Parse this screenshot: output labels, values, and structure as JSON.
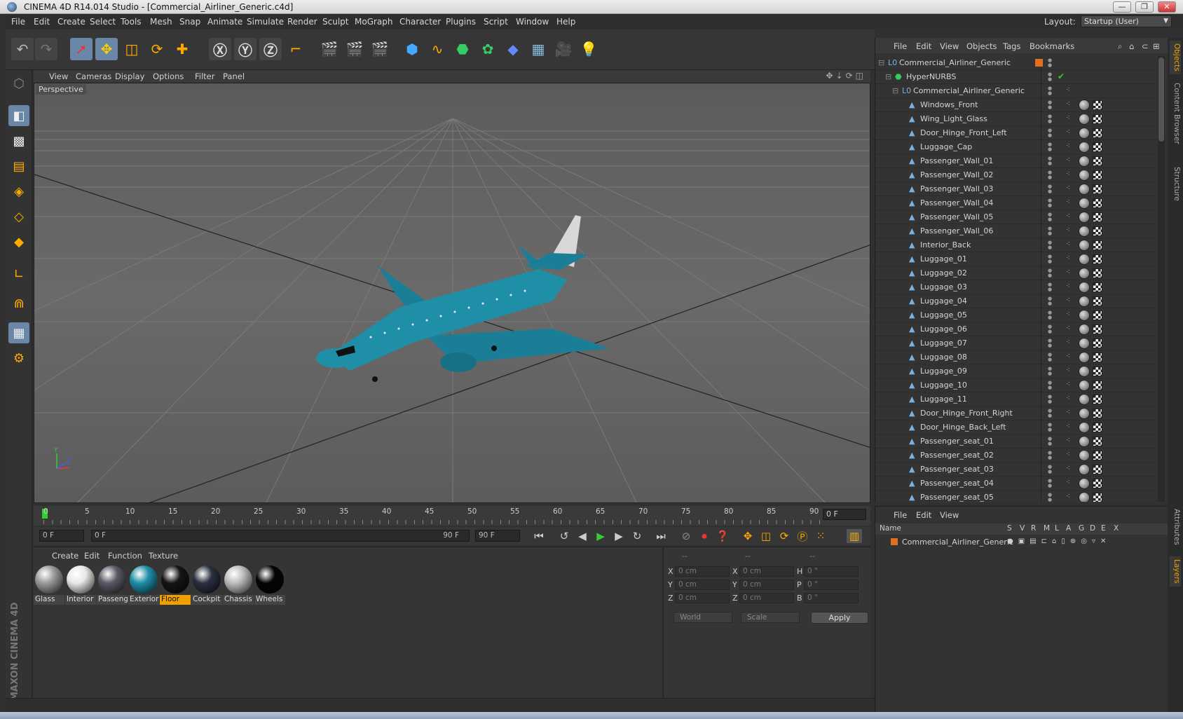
{
  "window": {
    "title": "CINEMA 4D R14.014 Studio - [Commercial_Airliner_Generic.c4d]"
  },
  "menu": {
    "items": [
      "File",
      "Edit",
      "Create",
      "Select",
      "Tools",
      "Mesh",
      "Snap",
      "Animate",
      "Simulate",
      "Render",
      "Sculpt",
      "MoGraph",
      "Character",
      "Plugins",
      "Script",
      "Window",
      "Help"
    ],
    "layout_label": "Layout:",
    "layout_value": "Startup (User)"
  },
  "viewport": {
    "menu": [
      "View",
      "Cameras",
      "Display",
      "Options",
      "Filter",
      "Panel"
    ],
    "label": "Perspective",
    "axis_labels": {
      "y": "Y",
      "z": "Z"
    }
  },
  "timeline": {
    "ticks": [
      "0",
      "5",
      "10",
      "15",
      "20",
      "25",
      "30",
      "35",
      "40",
      "45",
      "50",
      "55",
      "60",
      "65",
      "70",
      "75",
      "80",
      "85",
      "90"
    ],
    "current_frame": "0 F",
    "start_field": "0 F",
    "range_start": "0 F",
    "range_end": "90 F",
    "end_field": "90 F"
  },
  "materials": {
    "menu": [
      "Create",
      "Edit",
      "Function",
      "Texture"
    ],
    "items": [
      {
        "label": "Glass",
        "color": "#9a9a9a"
      },
      {
        "label": "Interior",
        "color": "#e8e8e8"
      },
      {
        "label": "Passeng",
        "color": "#5a5a66"
      },
      {
        "label": "Exterior",
        "color": "#1f8fa8"
      },
      {
        "label": "Floor",
        "color": "#151515"
      },
      {
        "label": "Cockpit",
        "color": "#2a3040"
      },
      {
        "label": "Chassis",
        "color": "#bdbdbd"
      },
      {
        "label": "Wheels",
        "color": "#050505"
      }
    ],
    "selected": "Floor"
  },
  "coordinates": {
    "headers": [
      "--",
      "--",
      "--"
    ],
    "rows": [
      {
        "a": "X",
        "av": "0 cm",
        "b": "X",
        "bv": "0 cm",
        "c": "H",
        "cv": "0 °"
      },
      {
        "a": "Y",
        "av": "0 cm",
        "b": "Y",
        "bv": "0 cm",
        "c": "P",
        "cv": "0 °"
      },
      {
        "a": "Z",
        "av": "0 cm",
        "b": "Z",
        "bv": "0 cm",
        "c": "B",
        "cv": "0 °"
      }
    ],
    "mode": "World",
    "scale": "Scale",
    "apply": "Apply"
  },
  "objects": {
    "menu": [
      "File",
      "Edit",
      "View",
      "Objects",
      "Tags",
      "Bookmarks"
    ],
    "tree": [
      {
        "name": "Commercial_Airliner_Generic",
        "level": 0,
        "icon": "null"
      },
      {
        "name": "HyperNURBS",
        "level": 1,
        "icon": "hypernurbs"
      },
      {
        "name": "Commercial_Airliner_Generic",
        "level": 2,
        "icon": "null"
      },
      {
        "name": "Windows_Front",
        "level": 3,
        "icon": "poly"
      },
      {
        "name": "Wing_Light_Glass",
        "level": 3,
        "icon": "poly"
      },
      {
        "name": "Door_Hinge_Front_Left",
        "level": 3,
        "icon": "poly"
      },
      {
        "name": "Luggage_Cap",
        "level": 3,
        "icon": "poly"
      },
      {
        "name": "Passenger_Wall_01",
        "level": 3,
        "icon": "poly"
      },
      {
        "name": "Passenger_Wall_02",
        "level": 3,
        "icon": "poly"
      },
      {
        "name": "Passenger_Wall_03",
        "level": 3,
        "icon": "poly"
      },
      {
        "name": "Passenger_Wall_04",
        "level": 3,
        "icon": "poly"
      },
      {
        "name": "Passenger_Wall_05",
        "level": 3,
        "icon": "poly"
      },
      {
        "name": "Passenger_Wall_06",
        "level": 3,
        "icon": "poly"
      },
      {
        "name": "Interior_Back",
        "level": 3,
        "icon": "poly"
      },
      {
        "name": "Luggage_01",
        "level": 3,
        "icon": "poly"
      },
      {
        "name": "Luggage_02",
        "level": 3,
        "icon": "poly"
      },
      {
        "name": "Luggage_03",
        "level": 3,
        "icon": "poly"
      },
      {
        "name": "Luggage_04",
        "level": 3,
        "icon": "poly"
      },
      {
        "name": "Luggage_05",
        "level": 3,
        "icon": "poly"
      },
      {
        "name": "Luggage_06",
        "level": 3,
        "icon": "poly"
      },
      {
        "name": "Luggage_07",
        "level": 3,
        "icon": "poly"
      },
      {
        "name": "Luggage_08",
        "level": 3,
        "icon": "poly"
      },
      {
        "name": "Luggage_09",
        "level": 3,
        "icon": "poly"
      },
      {
        "name": "Luggage_10",
        "level": 3,
        "icon": "poly"
      },
      {
        "name": "Luggage_11",
        "level": 3,
        "icon": "poly"
      },
      {
        "name": "Door_Hinge_Front_Right",
        "level": 3,
        "icon": "poly"
      },
      {
        "name": "Door_Hinge_Back_Left",
        "level": 3,
        "icon": "poly"
      },
      {
        "name": "Passenger_seat_01",
        "level": 3,
        "icon": "poly"
      },
      {
        "name": "Passenger_seat_02",
        "level": 3,
        "icon": "poly"
      },
      {
        "name": "Passenger_seat_03",
        "level": 3,
        "icon": "poly"
      },
      {
        "name": "Passenger_seat_04",
        "level": 3,
        "icon": "poly"
      },
      {
        "name": "Passenger_seat_05",
        "level": 3,
        "icon": "poly"
      }
    ]
  },
  "layers": {
    "menu": [
      "File",
      "Edit",
      "View"
    ],
    "columns": [
      "Name",
      "S",
      "V",
      "R",
      "M",
      "L",
      "A",
      "G",
      "D",
      "E",
      "X"
    ],
    "rows": [
      {
        "name": "Commercial_Airliner_Generic",
        "color": "#e07020"
      }
    ]
  },
  "side_tabs": [
    "Objects",
    "Content Browser",
    "Structure",
    "Attributes",
    "Layers"
  ],
  "brand": "MAXON CINEMA 4D",
  "colors": {
    "accent": "#6b87a8",
    "selection": "#f0a000",
    "aircraft": "#1f8fa8"
  }
}
